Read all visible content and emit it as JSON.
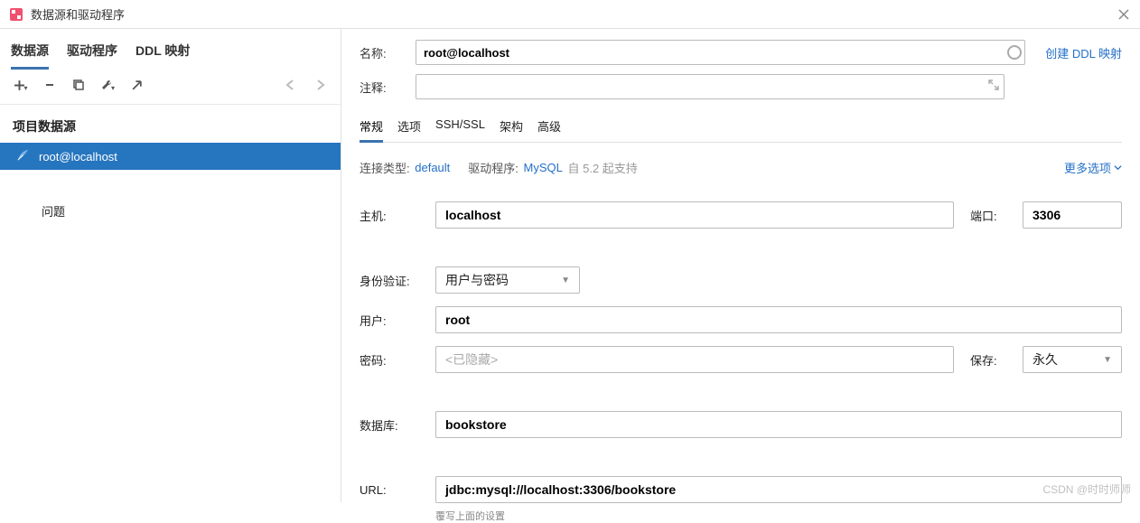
{
  "window": {
    "title": "数据源和驱动程序"
  },
  "left": {
    "tabs": [
      "数据源",
      "驱动程序",
      "DDL 映射"
    ],
    "active_tab": 0,
    "section_title": "项目数据源",
    "items": [
      {
        "label": "root@localhost",
        "selected": true
      }
    ],
    "problems_label": "问题"
  },
  "form": {
    "name_label": "名称:",
    "name_value": "root@localhost",
    "ddl_link": "创建 DDL 映射",
    "comment_label": "注释:",
    "comment_value": "",
    "sub_tabs": [
      "常规",
      "选项",
      "SSH/SSL",
      "架构",
      "高级"
    ],
    "active_sub_tab": 0,
    "conn_type_label": "连接类型:",
    "conn_type_value": "default",
    "driver_label": "驱动程序:",
    "driver_value": "MySQL",
    "driver_support": "自 5.2 起支持",
    "more_options": "更多选项",
    "host_label": "主机:",
    "host_value": "localhost",
    "port_label": "端口:",
    "port_value": "3306",
    "auth_label": "身份验证:",
    "auth_value": "用户与密码",
    "user_label": "用户:",
    "user_value": "root",
    "password_label": "密码:",
    "password_placeholder": "<已隐藏>",
    "save_label": "保存:",
    "save_value": "永久",
    "database_label": "数据库:",
    "database_value": "bookstore",
    "url_label": "URL:",
    "url_value": "jdbc:mysql://localhost:3306/bookstore",
    "url_hint": "覆写上面的设置"
  },
  "watermark": "CSDN @时时师师"
}
